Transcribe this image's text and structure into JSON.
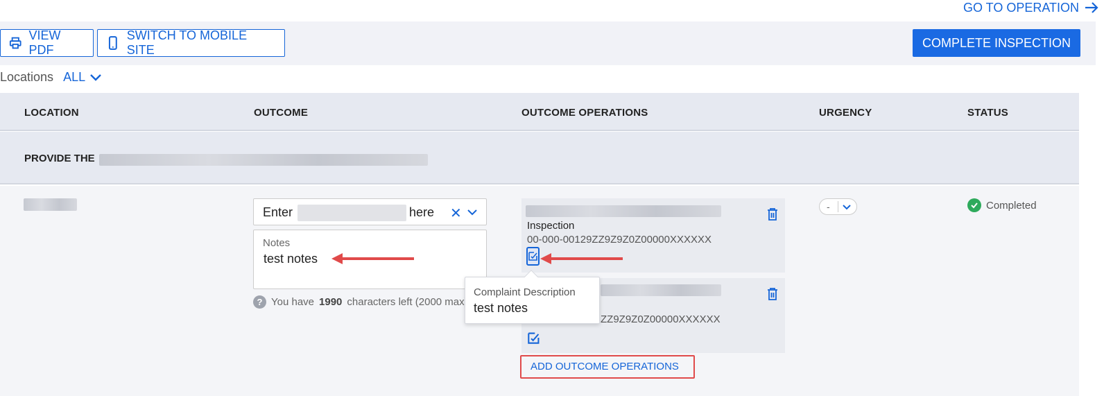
{
  "header": {
    "goto_label": "GO TO OPERATION"
  },
  "toolbar": {
    "view_pdf_label": "VIEW PDF",
    "mobile_label": "SWITCH TO MOBILE SITE",
    "complete_label": "COMPLETE INSPECTION"
  },
  "filter": {
    "label": "Locations",
    "value": "ALL"
  },
  "table": {
    "columns": [
      "LOCATION",
      "OUTCOME",
      "OUTCOME OPERATIONS",
      "URGENCY",
      "STATUS"
    ],
    "group_label": "PROVIDE THE"
  },
  "row": {
    "outcome": {
      "prefix": "Enter",
      "suffix": "here",
      "clear_glyph": "✕"
    },
    "notes": {
      "label": "Notes",
      "value": "test notes"
    },
    "chars": {
      "prefix": "You have",
      "count": "1990",
      "suffix": "characters left (2000 max)"
    },
    "operations": [
      {
        "name": "Inspection",
        "code": "00-000-00129ZZ9Z9Z0Z00000XXXXXX"
      },
      {
        "name": "",
        "code": "ZZ9Z9Z0Z00000XXXXXX"
      }
    ],
    "add_ops_label": "ADD OUTCOME OPERATIONS",
    "tooltip": {
      "title": "Complaint Description",
      "value": "test notes"
    },
    "urgency": "-",
    "status": "Completed"
  },
  "colors": {
    "accent": "#1565d8",
    "primary_button": "#1a6ae3",
    "header_bg": "#e6e9f1",
    "row_bg": "#f4f5f8",
    "success": "#2eaa5c",
    "annotation_red": "#e04a4a"
  },
  "icons": [
    "arrow-right-icon",
    "printer-icon",
    "mobile-phone-icon",
    "chevron-down-icon",
    "close-icon",
    "help-icon",
    "trash-icon",
    "edit-icon",
    "check-circle-icon"
  ]
}
